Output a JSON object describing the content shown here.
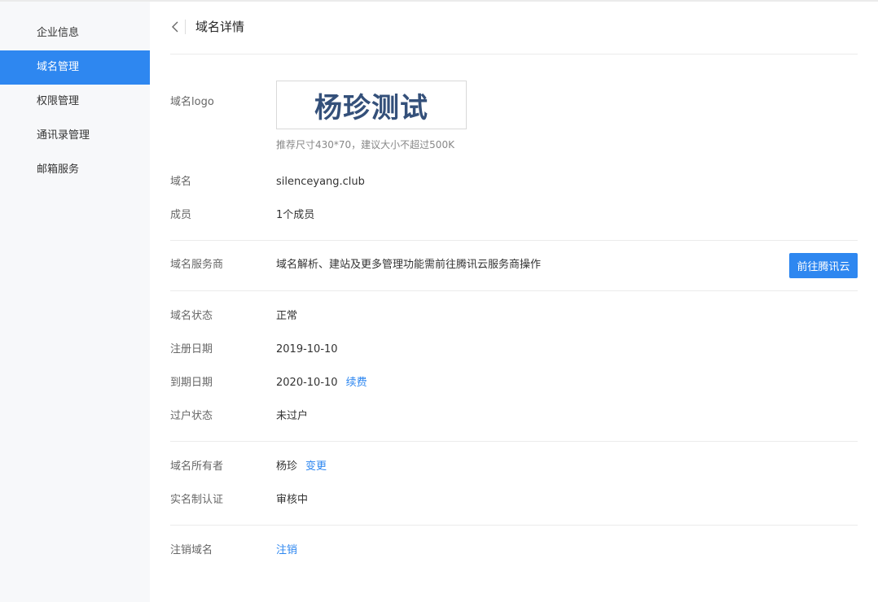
{
  "sidebar": {
    "items": [
      {
        "label": "企业信息"
      },
      {
        "label": "域名管理",
        "active": true
      },
      {
        "label": "权限管理"
      },
      {
        "label": "通讯录管理"
      },
      {
        "label": "邮箱服务"
      }
    ]
  },
  "header": {
    "back_icon": "chevron-left-icon",
    "title": "域名详情"
  },
  "logo": {
    "label": "域名logo",
    "logo_text": "杨珍测试",
    "hint": "推荐尺寸430*70，建议大小不超过500K"
  },
  "domain": {
    "label": "域名",
    "value": "silenceyang.club"
  },
  "members": {
    "label": "成员",
    "value": "1个成员"
  },
  "provider": {
    "label": "域名服务商",
    "value": "域名解析、建站及更多管理功能需前往腾讯云服务商操作",
    "button_label": "前往腾讯云"
  },
  "status": {
    "label": "域名状态",
    "value": "正常"
  },
  "register_date": {
    "label": "注册日期",
    "value": "2019-10-10"
  },
  "expire_date": {
    "label": "到期日期",
    "value": "2020-10-10",
    "link": "续费"
  },
  "transfer": {
    "label": "过户状态",
    "value": "未过户"
  },
  "owner": {
    "label": "域名所有者",
    "value": "杨珍",
    "link": "变更"
  },
  "verification": {
    "label": "实名制认证",
    "value": "审核中"
  },
  "cancel": {
    "label": "注销域名",
    "link": "注销"
  },
  "colors": {
    "accent": "#2e87f0",
    "sidebar_bg": "#f7f8fa",
    "logo_text": "#34507a"
  }
}
